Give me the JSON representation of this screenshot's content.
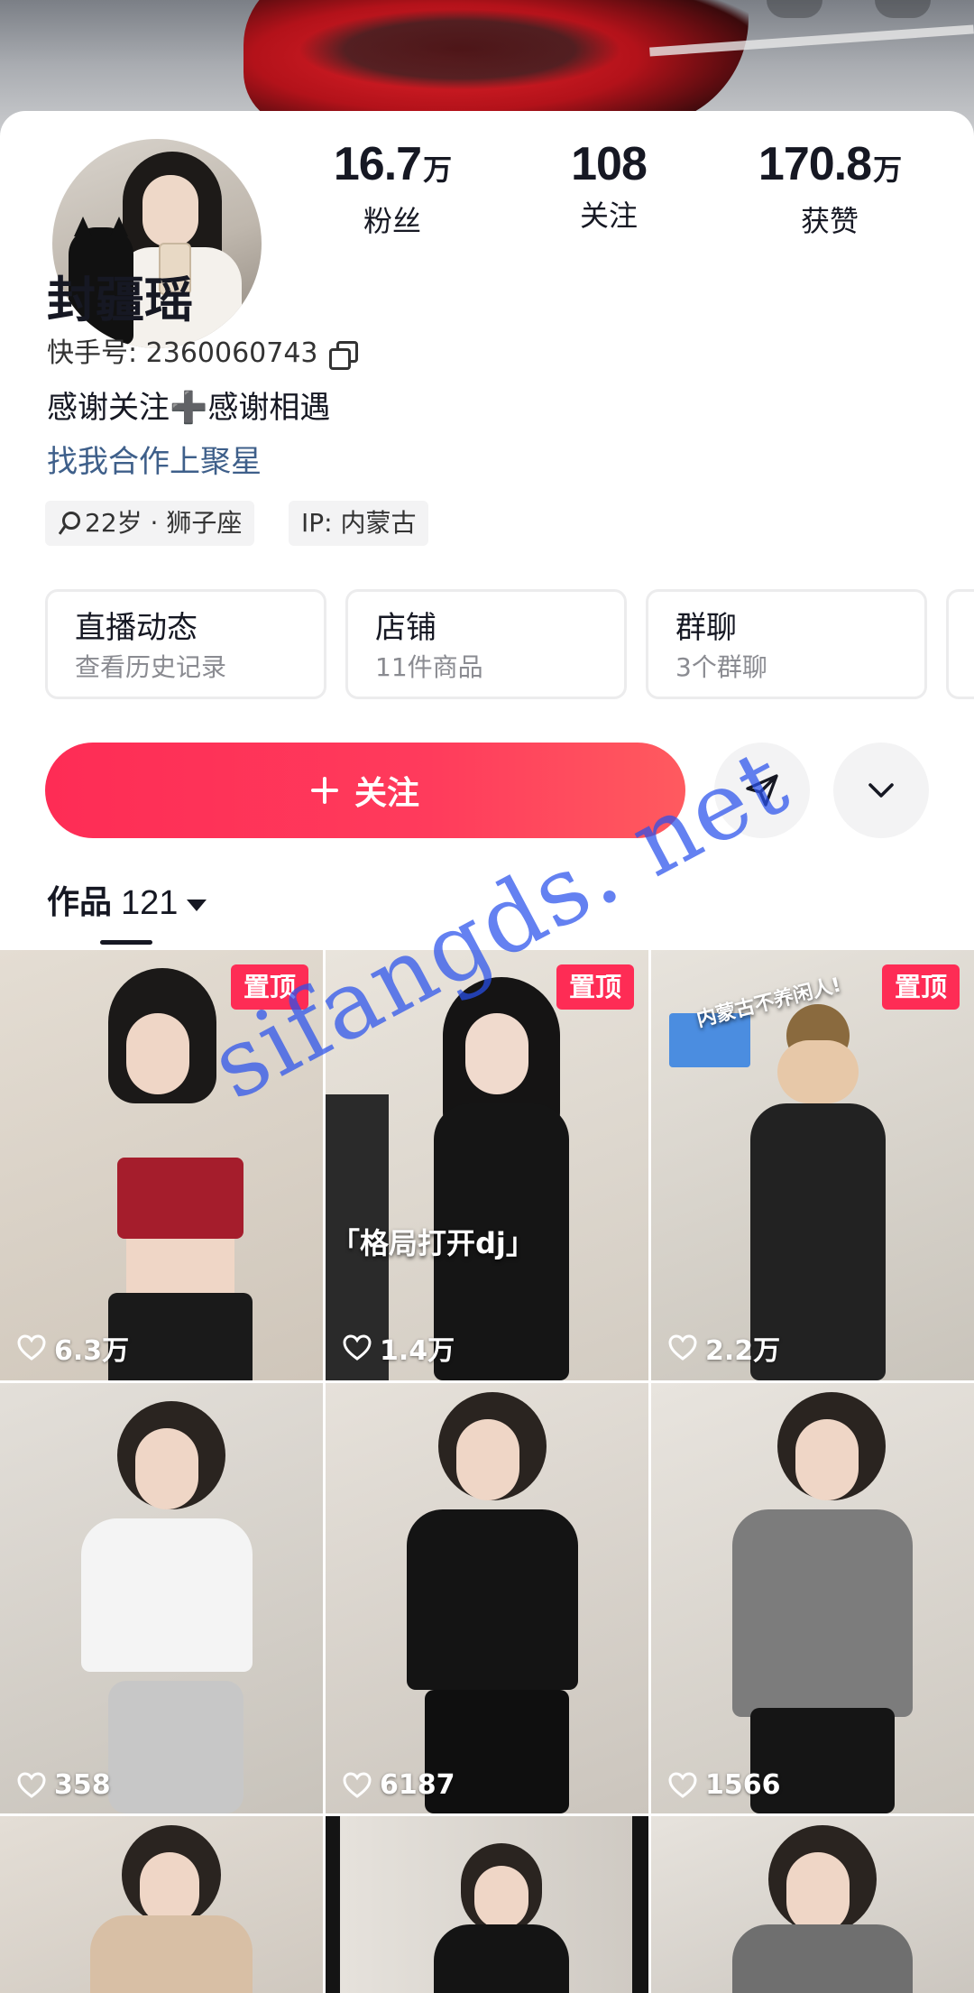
{
  "profile": {
    "nickname": "封疆瑶",
    "ks_id": "快手号: 2360060743",
    "bio": "感谢关注➕感谢相遇",
    "bio_link": "找我合作上聚星",
    "tags": {
      "age": "22岁 · 狮子座",
      "ip": "IP: 内蒙古"
    }
  },
  "stats": {
    "fans": {
      "value": "16.7",
      "unit": "万",
      "label": "粉丝"
    },
    "following": {
      "value": "108",
      "unit": "",
      "label": "关注"
    },
    "likes": {
      "value": "170.8",
      "unit": "万",
      "label": "获赞"
    }
  },
  "feature_boxes": [
    {
      "title": "直播动态",
      "subtitle": "查看历史记录"
    },
    {
      "title": "店铺",
      "subtitle": "11件商品"
    },
    {
      "title": "群聊",
      "subtitle": "3个群聊"
    }
  ],
  "actions": {
    "follow_label": "关注"
  },
  "works": {
    "label": "作品",
    "count": "121"
  },
  "videos": [
    {
      "likes": "6.3万",
      "pinned": "置顶"
    },
    {
      "likes": "1.4万",
      "pinned": "置顶",
      "caption": "「格局打开dj」"
    },
    {
      "likes": "2.2万",
      "pinned": "置顶",
      "caption": "内蒙古不养闲人!"
    },
    {
      "likes": "358"
    },
    {
      "likes": "6187"
    },
    {
      "likes": "1566"
    },
    {},
    {},
    {}
  ],
  "watermark": "sifangds. net",
  "colors": {
    "accent": "#fe2c55",
    "link": "#3e5f8a",
    "watermark": "#2850eb"
  }
}
